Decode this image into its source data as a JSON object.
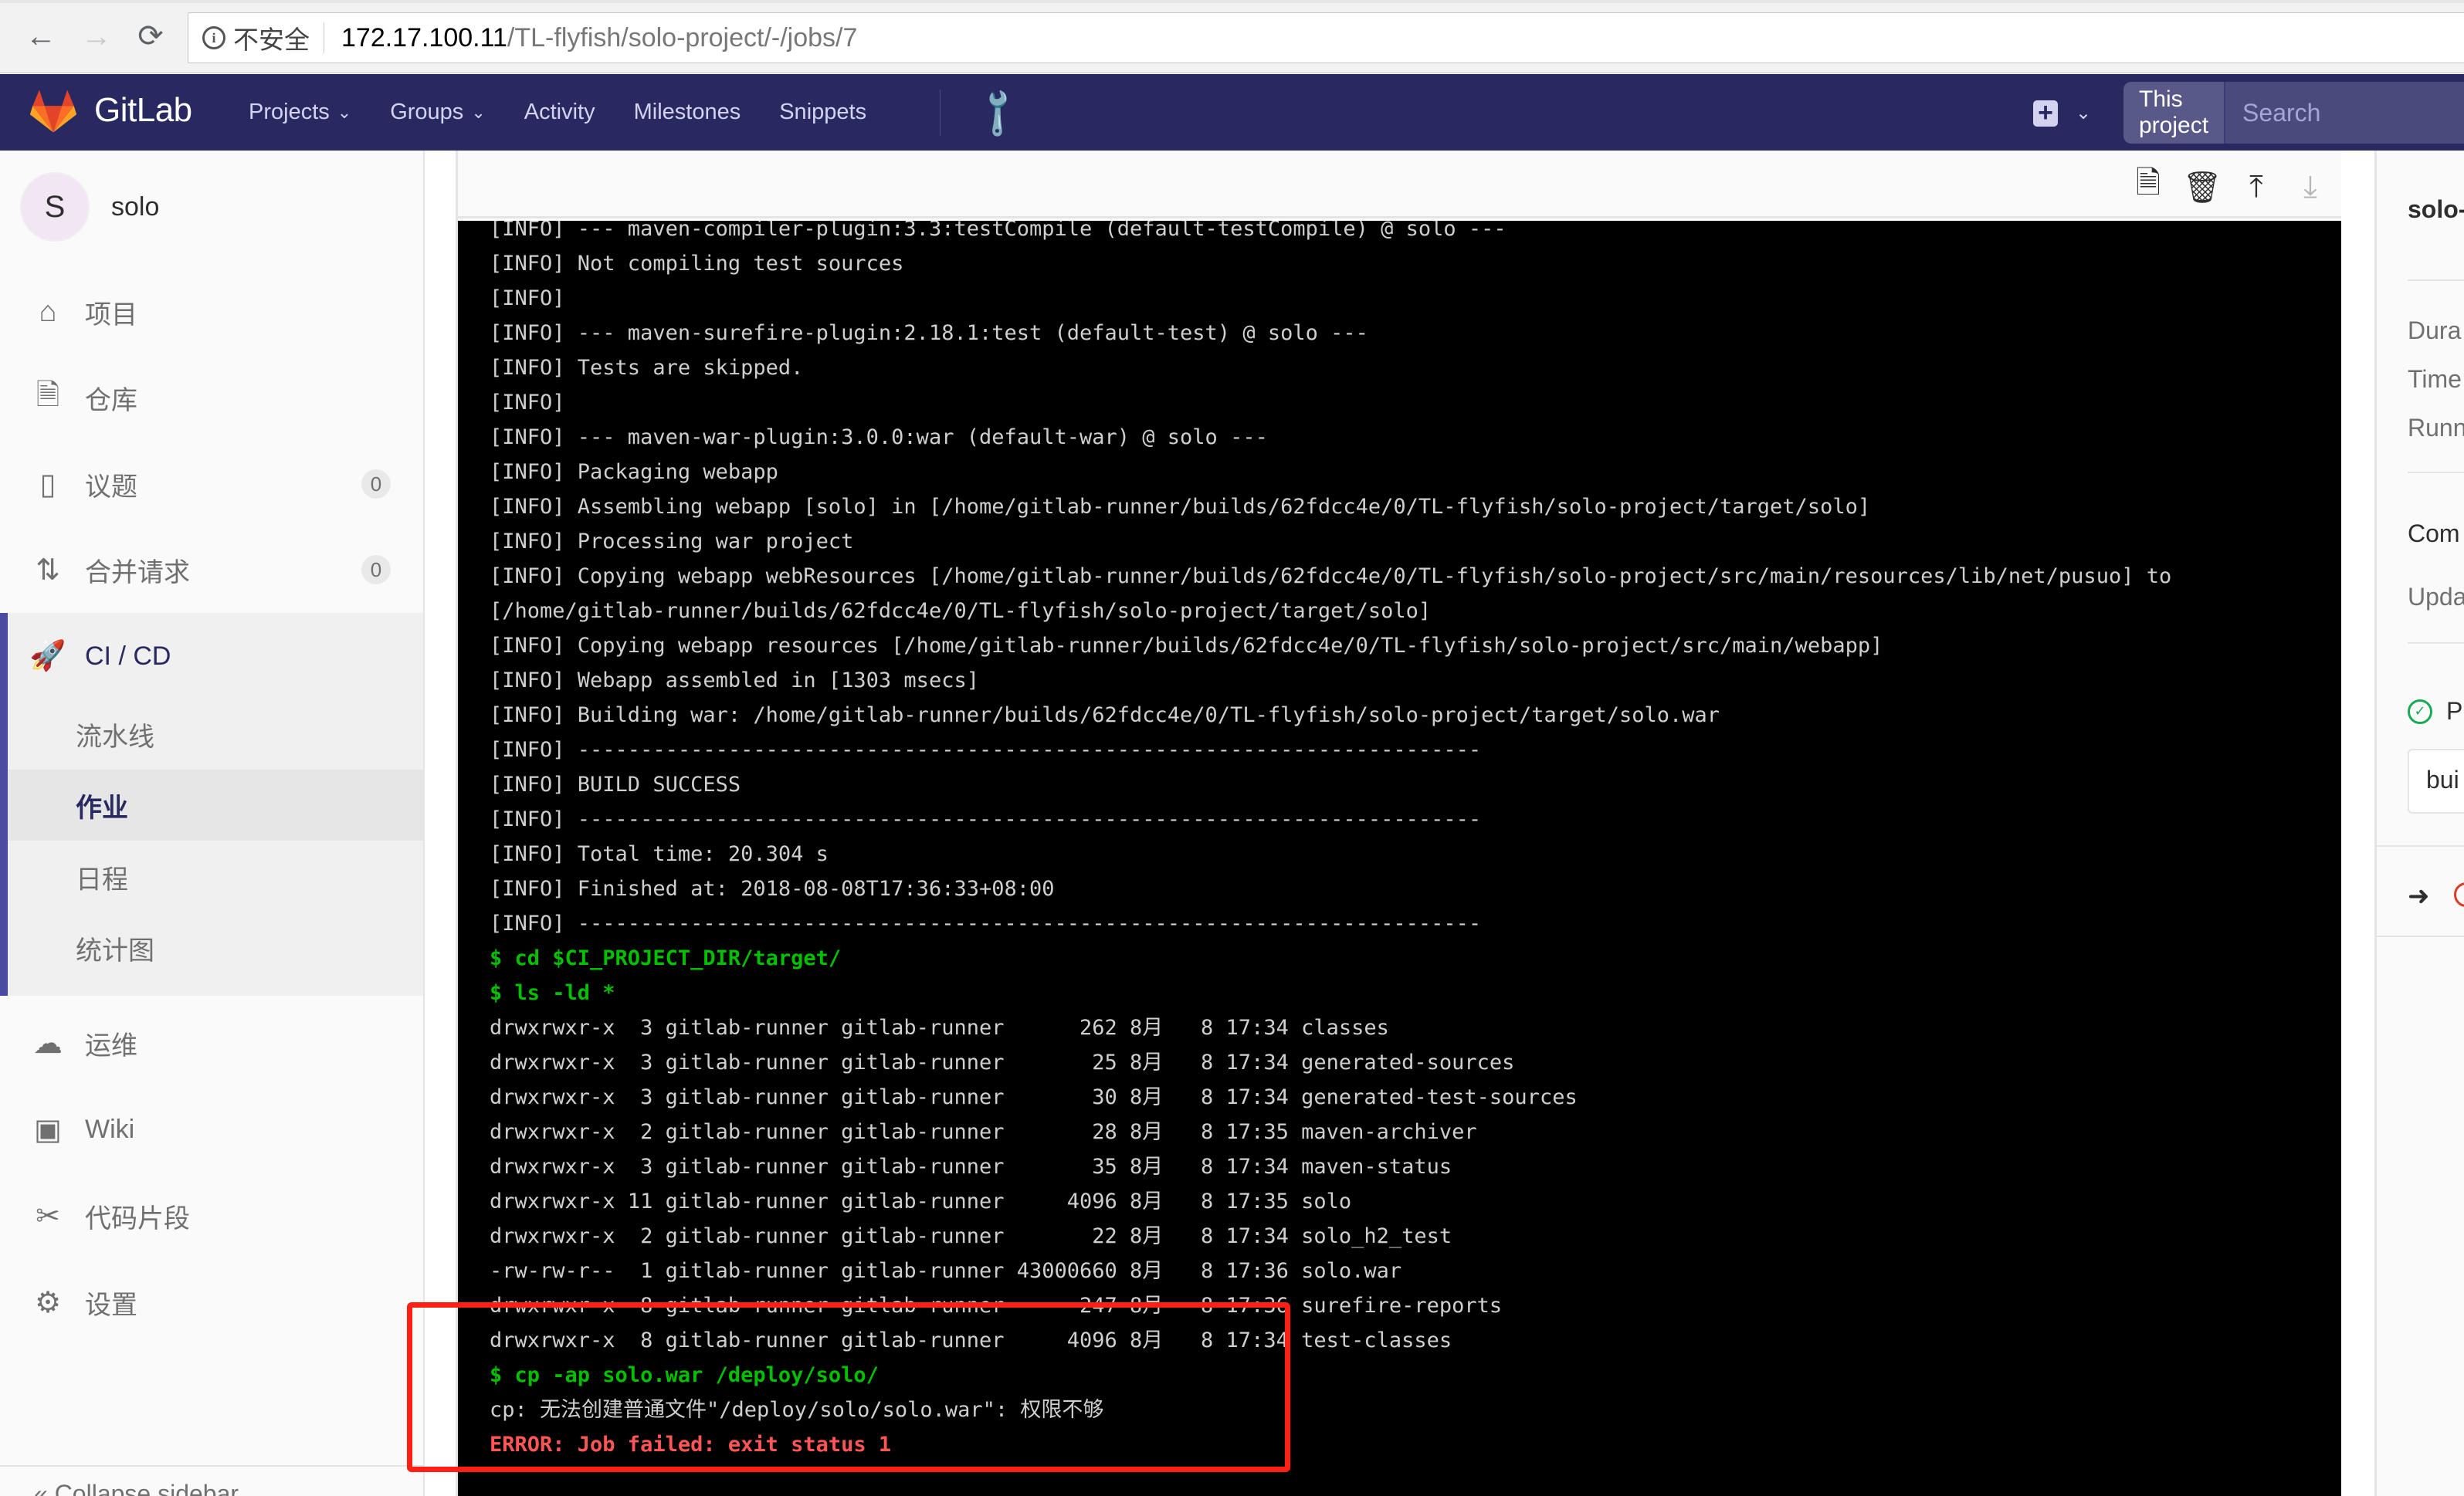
{
  "browser": {
    "security_label": "不安全",
    "url_host": "172.17.100.11",
    "url_path": "/TL-flyfish/solo-project/-/jobs/7"
  },
  "navbar": {
    "brand": "GitLab",
    "links": [
      {
        "label": "Projects",
        "dropdown": true
      },
      {
        "label": "Groups",
        "dropdown": true
      },
      {
        "label": "Activity",
        "dropdown": false
      },
      {
        "label": "Milestones",
        "dropdown": false
      },
      {
        "label": "Snippets",
        "dropdown": false
      }
    ],
    "search_scope": "This project",
    "search_placeholder": "Search"
  },
  "sidebar": {
    "project_initial": "S",
    "project_name": "solo",
    "items": [
      {
        "label": "项目",
        "icon": "home-icon"
      },
      {
        "label": "仓库",
        "icon": "doc-icon"
      },
      {
        "label": "议题",
        "icon": "issues-icon",
        "badge": "0"
      },
      {
        "label": "合并请求",
        "icon": "merge-request-icon",
        "badge": "0"
      },
      {
        "label": "CI / CD",
        "icon": "rocket-icon"
      },
      {
        "label": "运维",
        "icon": "cloud-gear-icon"
      },
      {
        "label": "Wiki",
        "icon": "book-icon"
      },
      {
        "label": "代码片段",
        "icon": "scissors-icon"
      },
      {
        "label": "设置",
        "icon": "gear-icon"
      }
    ],
    "ci_sub_items": [
      {
        "label": "流水线",
        "active": false
      },
      {
        "label": "作业",
        "active": true
      },
      {
        "label": "日程",
        "active": false
      },
      {
        "label": "统计图",
        "active": false
      }
    ],
    "collapse_label": "Collapse sidebar"
  },
  "job_log": {
    "lines": [
      {
        "type": "info",
        "text": "[INFO] --- maven-compiler-plugin:3.3:testCompile (default-testCompile) @ solo ---"
      },
      {
        "type": "info",
        "text": "[INFO] Not compiling test sources"
      },
      {
        "type": "info",
        "text": "[INFO]"
      },
      {
        "type": "info",
        "text": "[INFO] --- maven-surefire-plugin:2.18.1:test (default-test) @ solo ---"
      },
      {
        "type": "info",
        "text": "[INFO] Tests are skipped."
      },
      {
        "type": "info",
        "text": "[INFO]"
      },
      {
        "type": "info",
        "text": "[INFO] --- maven-war-plugin:3.0.0:war (default-war) @ solo ---"
      },
      {
        "type": "info",
        "text": "[INFO] Packaging webapp"
      },
      {
        "type": "info",
        "text": "[INFO] Assembling webapp [solo] in [/home/gitlab-runner/builds/62fdcc4e/0/TL-flyfish/solo-project/target/solo]"
      },
      {
        "type": "info",
        "text": "[INFO] Processing war project"
      },
      {
        "type": "info",
        "text": "[INFO] Copying webapp webResources [/home/gitlab-runner/builds/62fdcc4e/0/TL-flyfish/solo-project/src/main/resources/lib/net/pusuo] to"
      },
      {
        "type": "info",
        "text": "[/home/gitlab-runner/builds/62fdcc4e/0/TL-flyfish/solo-project/target/solo]"
      },
      {
        "type": "info",
        "text": "[INFO] Copying webapp resources [/home/gitlab-runner/builds/62fdcc4e/0/TL-flyfish/solo-project/src/main/webapp]"
      },
      {
        "type": "info",
        "text": "[INFO] Webapp assembled in [1303 msecs]"
      },
      {
        "type": "info",
        "text": "[INFO] Building war: /home/gitlab-runner/builds/62fdcc4e/0/TL-flyfish/solo-project/target/solo.war"
      },
      {
        "type": "info",
        "text": "[INFO] ------------------------------------------------------------------------"
      },
      {
        "type": "info",
        "text": "[INFO] BUILD SUCCESS"
      },
      {
        "type": "info",
        "text": "[INFO] ------------------------------------------------------------------------"
      },
      {
        "type": "info",
        "text": "[INFO] Total time: 20.304 s"
      },
      {
        "type": "info",
        "text": "[INFO] Finished at: 2018-08-08T17:36:33+08:00"
      },
      {
        "type": "info",
        "text": "[INFO] ------------------------------------------------------------------------"
      },
      {
        "type": "cmd",
        "text": "$ cd $CI_PROJECT_DIR/target/"
      },
      {
        "type": "cmd",
        "text": "$ ls -ld *"
      },
      {
        "type": "info",
        "text": "drwxrwxr-x  3 gitlab-runner gitlab-runner      262 8月   8 17:34 classes"
      },
      {
        "type": "info",
        "text": "drwxrwxr-x  3 gitlab-runner gitlab-runner       25 8月   8 17:34 generated-sources"
      },
      {
        "type": "info",
        "text": "drwxrwxr-x  3 gitlab-runner gitlab-runner       30 8月   8 17:34 generated-test-sources"
      },
      {
        "type": "info",
        "text": "drwxrwxr-x  2 gitlab-runner gitlab-runner       28 8月   8 17:35 maven-archiver"
      },
      {
        "type": "info",
        "text": "drwxrwxr-x  3 gitlab-runner gitlab-runner       35 8月   8 17:34 maven-status"
      },
      {
        "type": "info",
        "text": "drwxrwxr-x 11 gitlab-runner gitlab-runner     4096 8月   8 17:35 solo"
      },
      {
        "type": "info",
        "text": "drwxrwxr-x  2 gitlab-runner gitlab-runner       22 8月   8 17:34 solo_h2_test"
      },
      {
        "type": "info",
        "text": "-rw-rw-r--  1 gitlab-runner gitlab-runner 43000660 8月   8 17:36 solo.war"
      },
      {
        "type": "info",
        "text": "drwxrwxr-x  8 gitlab-runner gitlab-runner      247 8月   8 17:36 surefire-reports"
      },
      {
        "type": "info",
        "text": "drwxrwxr-x  8 gitlab-runner gitlab-runner     4096 8月   8 17:34 test-classes"
      },
      {
        "type": "cmd",
        "text": "$ cp -ap solo.war /deploy/solo/"
      },
      {
        "type": "info",
        "text": "cp: 无法创建普通文件\"/deploy/solo/solo.war\": 权限不够"
      },
      {
        "type": "err",
        "text": "ERROR: Job failed: exit status 1"
      }
    ]
  },
  "log_toolbar": {
    "raw_label": "Show complete raw",
    "erase_label": "Erase job log",
    "top_label": "Scroll to top",
    "bottom_label": "Scroll to bottom"
  },
  "right_panel": {
    "job_title": "solo-",
    "rows": [
      "Dura",
      "Time",
      "Runn"
    ],
    "commit_label": "Com",
    "updated_label": "Upda",
    "pipeline_label": "Pi",
    "stage_label": "bui"
  },
  "colors": {
    "navbar": "#292961",
    "accent": "#4b4ba3",
    "cmd_green": "#00c000",
    "error_red": "#ff5555",
    "annotation_red": "#ff2015",
    "success_green": "#1aaa55"
  }
}
